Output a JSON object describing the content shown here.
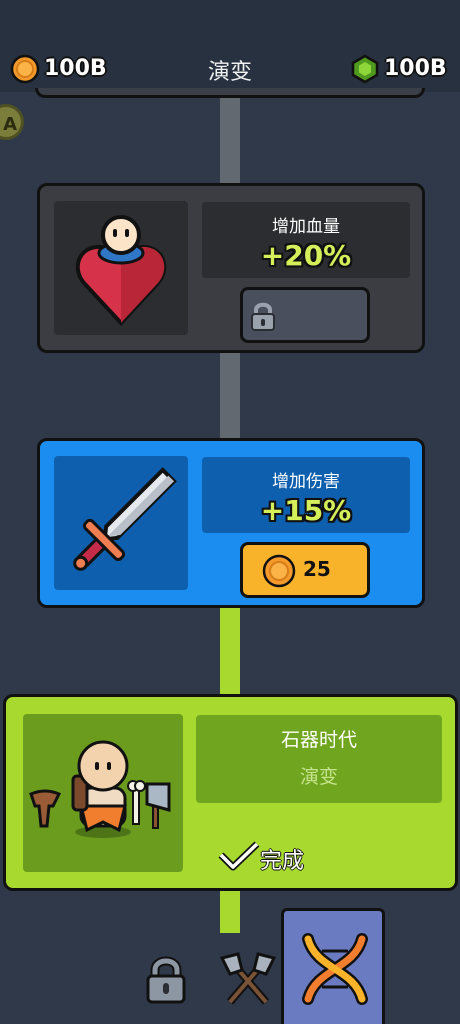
{
  "header": {
    "coins": "100B",
    "title": "演变",
    "gems": "100B",
    "coin_icon": "coin-icon",
    "gem_icon": "gem-icon"
  },
  "side_badge": {
    "label": "A"
  },
  "cards": [
    {
      "id": "health",
      "state": "locked",
      "icon": "heart-character-icon",
      "label": "增加血量",
      "value": "+20%",
      "button_icon": "lock-icon"
    },
    {
      "id": "damage",
      "state": "available",
      "icon": "sword-icon",
      "label": "增加伤害",
      "value": "+15%",
      "button_icon": "coin-icon",
      "button_cost": "25"
    },
    {
      "id": "stone-age",
      "state": "completed",
      "icon": "caveman-icon",
      "label": "石器时代",
      "sub_label": "演变",
      "status": "完成",
      "status_icon": "checkmark-icon"
    }
  ],
  "bottom_nav": [
    {
      "name": "locked-tab",
      "icon": "lock-icon",
      "active": false
    },
    {
      "name": "weapons-tab",
      "icon": "crossed-axes-icon",
      "active": false
    },
    {
      "name": "evolution-tab",
      "icon": "dna-icon",
      "active": true
    }
  ],
  "colors": {
    "background": "#2f394a",
    "locked_card": "#3b3d42",
    "available_card": "#1b8df0",
    "completed_card": "#a7d92e",
    "accent_yellow": "#f9b32b",
    "value_green": "#d5ef5a"
  }
}
